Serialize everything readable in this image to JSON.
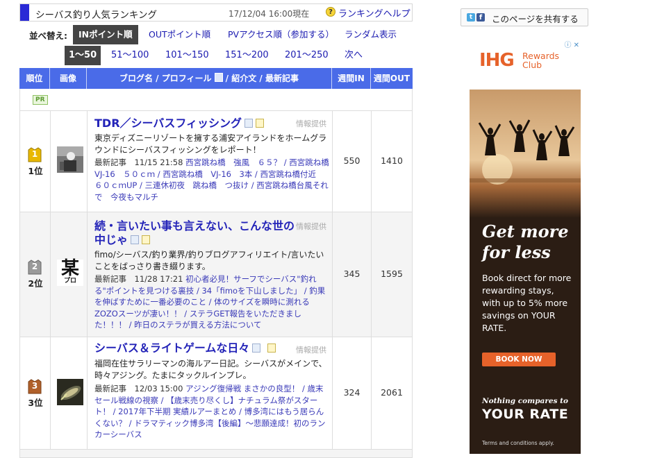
{
  "header": {
    "title": "シーバス釣り人気ランキング",
    "date": "17/12/04 16:00現在",
    "help_icon": "question-icon",
    "help_label": "ランキングヘルプ"
  },
  "sort": {
    "label": "並べ替え:",
    "options": [
      "INポイント順",
      "OUTポイント順",
      "PVアクセス順（参加する）",
      "ランダム表示"
    ],
    "selected": "INポイント順"
  },
  "pages": {
    "items": [
      "1～50",
      "51～100",
      "101～150",
      "151～200",
      "201～250",
      "次へ"
    ],
    "selected": "1～50"
  },
  "table": {
    "headers": {
      "rank": "順位",
      "image": "画像",
      "blog": "ブログ名 / プロフィール",
      "blog_rest": " / 紹介文 / 最新記事",
      "in": "週間IN",
      "out": "週間OUT"
    },
    "pr_badge": "PR",
    "rows": [
      {
        "medal_num": "1",
        "rank_label": "1位",
        "medal_color": "#e8b800",
        "title": "TDR／シーバスフィッシング",
        "info": "情報提供",
        "description": "東京ディズニーリゾートを擁する浦安アイランドをホームグラウンドにシーバスフィッシングをレポート！",
        "latest_prefix": "最新記事　11/15 21:58 ",
        "latest_links": "西宮跳ね橋　強風　６５？ / 西宮跳ね橋　VJ-16　５０ｃｍ / 西宮跳ね橋　VJ-16　3本 / 西宮跳ね橋付近　６０ｃｍUP / 三連休初夜　跳ね橋　つ抜け / 西宮跳ね橋台風それで　今夜もマルチ",
        "in": "550",
        "out": "1410"
      },
      {
        "medal_num": "2",
        "rank_label": "2位",
        "medal_color": "#9a9a9a",
        "title": "続・言いたい事も言えない、こんな世の中じゃ",
        "info": "情報提供",
        "thumb_text": "某",
        "thumb_sub": "プロ",
        "description": "fimo/シーバス/釣り業界/釣りブログアフィリエイト/言いたいことをばっさり書き綴ります。",
        "latest_prefix": "最新記事　11/28 17:21 ",
        "latest_links": "初心者必見！サーフでシーバス\"釣れる\"ポイントを見つける裏技 / 34「fimoを下山しました」 / 釣果を伸ばすために一番必要のこと / 体のサイズを瞬時に測れるZOZOスーツが凄い！！ / ステラGET報告をいただきました！！！ / 昨日のステラが買える方法について",
        "in": "345",
        "out": "1595"
      },
      {
        "medal_num": "3",
        "rank_label": "3位",
        "medal_color": "#b0602a",
        "title": "シーバス＆ライトゲームな日々",
        "info": "情報提供",
        "description": "福岡在住サラリーマンの海ルアー日記。シーバスがメインで、時々アジング。たまにタックルインプレ。",
        "latest_prefix": "最新記事　12/03 15:00 ",
        "latest_links": "アジング復帰戦 まさかの良型！ / 歳末セール戦線の視察 / 【歳末売り尽くし】ナチュラム祭がスタート！ / 2017年下半期 実績ルアーまとめ / 博多湾にはもう居らんくない？ / ドラマティック博多湾【後編】～悲願達成！初のランカーシーバス",
        "in": "324",
        "out": "2061"
      }
    ]
  },
  "share": {
    "twitter_icon": "twitter-icon",
    "facebook_icon": "facebook-icon",
    "label": "このページを共有する"
  },
  "ad": {
    "brand": "IHG",
    "brand_sub1": "Rewards",
    "brand_sub2": "Club",
    "close_icon": "close-icon",
    "headline1": "Get more",
    "headline2": "for less",
    "body": "Book direct for more rewarding stays, with up to 5% more savings on YOUR RATE.",
    "cta": "BOOK NOW",
    "tagline1": "Nothing compares to",
    "tagline2": "YOUR RATE",
    "terms": "Terms and conditions apply."
  }
}
